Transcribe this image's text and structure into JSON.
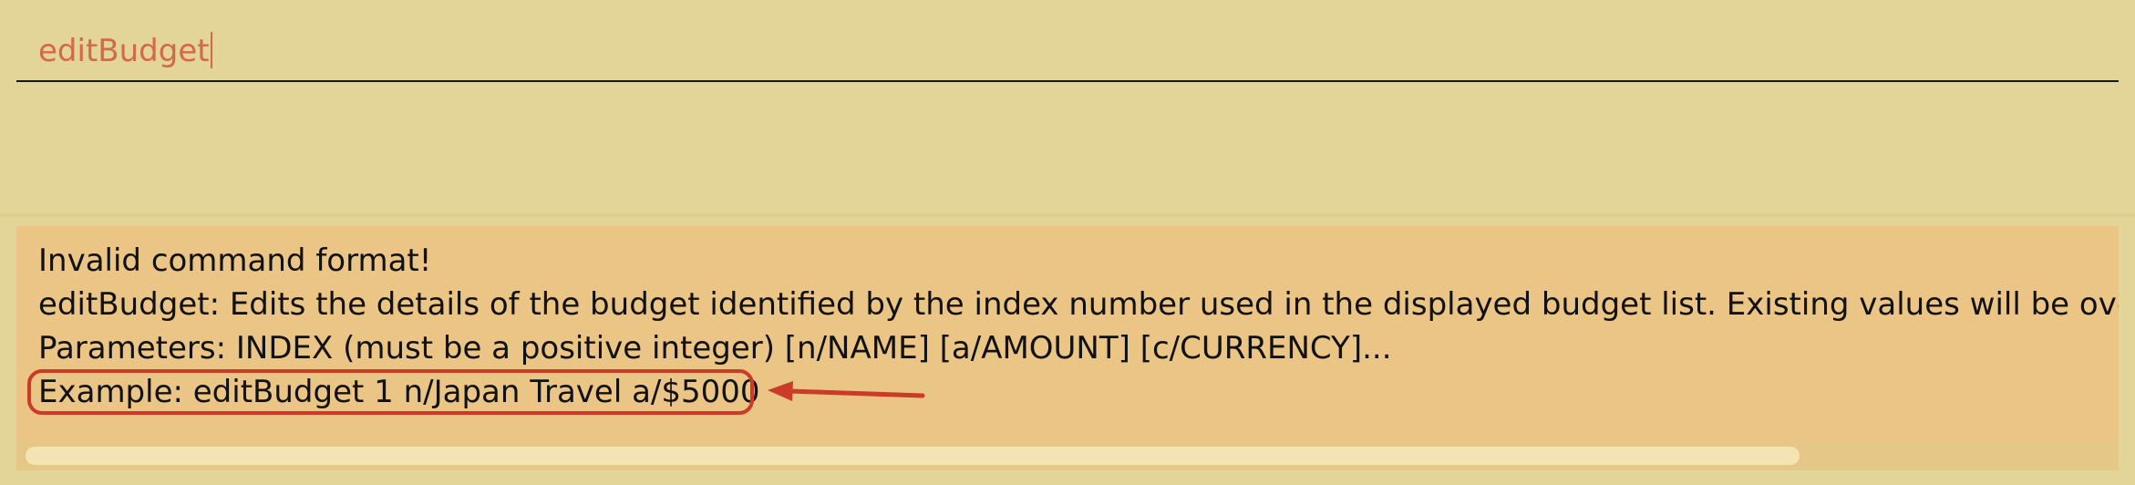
{
  "command_box": {
    "input_value": "editBudget"
  },
  "result_display": {
    "lines": [
      "Invalid command format!",
      "editBudget: Edits the details of the budget identified by the index number used in the displayed budget list. Existing values will be overwritten by the input values.",
      "Parameters: INDEX (must be a positive integer) [n/NAME] [a/AMOUNT] [c/CURRENCY]...",
      "Example: editBudget 1 n/Japan Travel a/$5000"
    ]
  },
  "colors": {
    "background": "#e2d597",
    "input_text": "#d2694b",
    "result_panel": "#eac585",
    "annotation": "#cc3a28"
  },
  "icons": {
    "annotation_arrow": "left-arrow-icon"
  }
}
